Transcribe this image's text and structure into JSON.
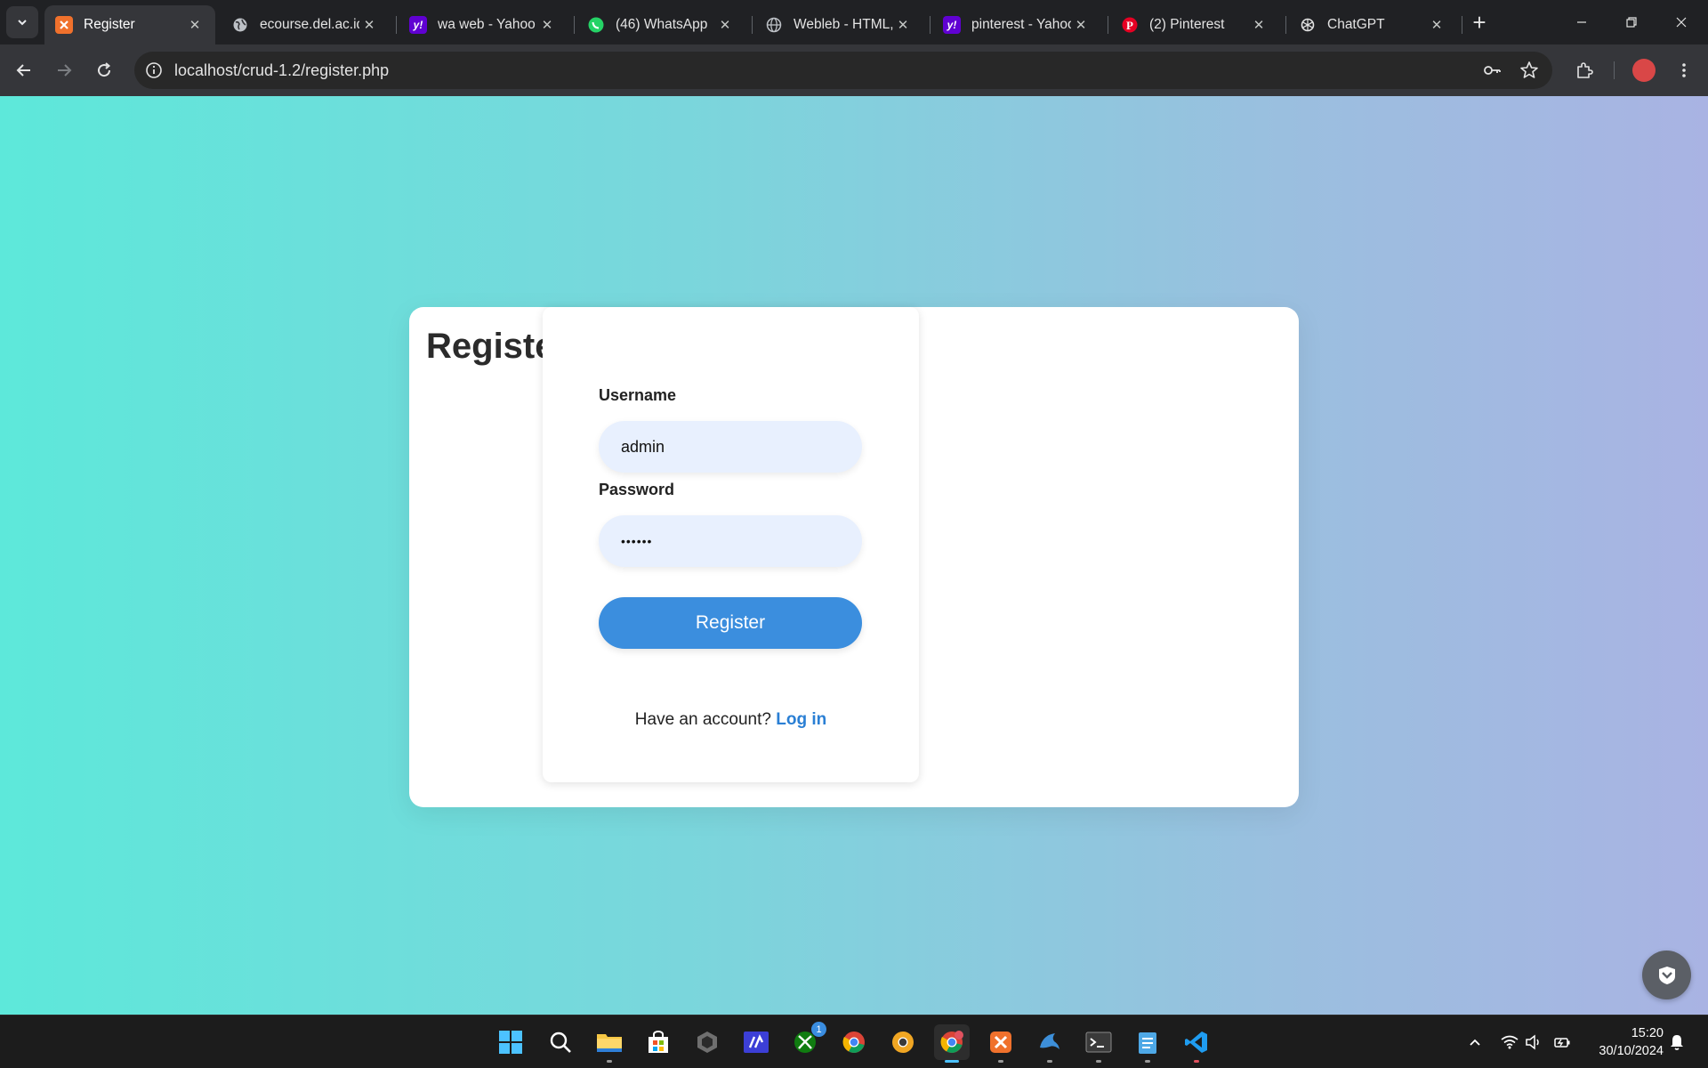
{
  "browser": {
    "tabs": [
      {
        "title": "Register",
        "icon": "xampp-icon",
        "active": true
      },
      {
        "title": "ecourse.del.ac.id",
        "icon": "globe-icon"
      },
      {
        "title": "wa web - Yahoo S",
        "icon": "yahoo-icon"
      },
      {
        "title": "(46) WhatsApp",
        "icon": "whatsapp-icon"
      },
      {
        "title": "Webleb - HTML,",
        "icon": "globe-icon"
      },
      {
        "title": "pinterest - Yahoo",
        "icon": "yahoo-icon"
      },
      {
        "title": "(2) Pinterest",
        "icon": "pinterest-icon"
      },
      {
        "title": "ChatGPT",
        "icon": "chatgpt-icon"
      }
    ],
    "url": "localhost/crud-1.2/register.php"
  },
  "page": {
    "heading": "Registe",
    "form": {
      "username_label": "Username",
      "username_value": "admin",
      "password_label": "Password",
      "password_value": "••••••",
      "submit_label": "Register",
      "footer_text": "Have an account?",
      "login_link": "Log in"
    },
    "colors": {
      "gradient_start": "#5de8da",
      "gradient_end": "#a9b3e3",
      "button": "#3b8ede",
      "link": "#2a7fd4"
    }
  },
  "taskbar": {
    "apps": [
      "windows-start-icon",
      "search-icon",
      "file-explorer-icon",
      "microsoft-store-icon",
      "unity-icon",
      "visual-studio-icon",
      "xbox-icon",
      "chrome-icon",
      "chrome-canary-icon",
      "chrome-profile-icon",
      "xampp-icon",
      "mysql-workbench-icon",
      "terminal-icon",
      "notepad-icon",
      "vscode-icon"
    ],
    "xbox_badge": "1",
    "time": "15:20",
    "date": "30/10/2024"
  }
}
